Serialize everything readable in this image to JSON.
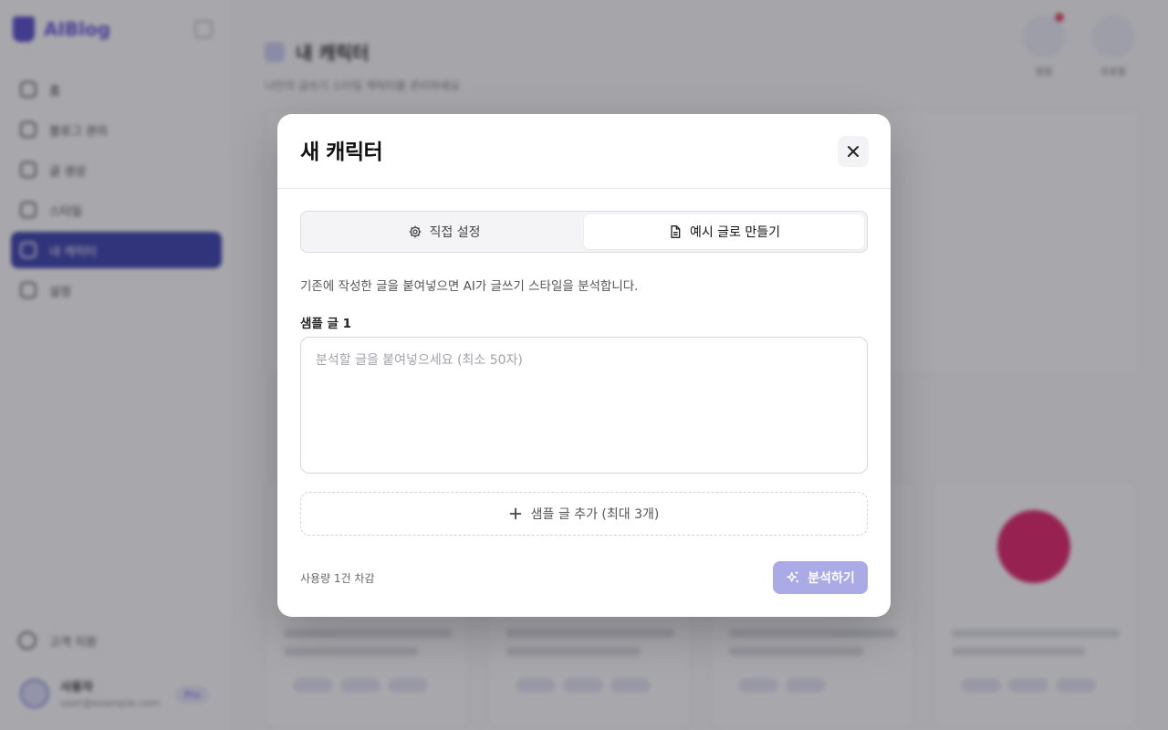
{
  "sidebar": {
    "brand": "AIBlog",
    "items": [
      {
        "label": "홈",
        "icon": "home-icon"
      },
      {
        "label": "블로그 관리",
        "icon": "link-icon"
      },
      {
        "label": "글 생성",
        "icon": "pen-icon"
      },
      {
        "label": "스타일",
        "icon": "palette-icon"
      },
      {
        "label": "내 캐릭터",
        "icon": "character-icon",
        "active": true
      },
      {
        "label": "설정",
        "icon": "gear-icon"
      }
    ],
    "bottom_link": "고객 지원",
    "user": {
      "name": "사용자",
      "email": "user@example.com",
      "plan": "Pro"
    }
  },
  "page": {
    "title": "내 캐릭터",
    "subtitle": "나만의 글쓰기 스타일 캐릭터를 관리하세요",
    "top_icons": [
      {
        "label": "알림",
        "icon": "bell-icon",
        "has_badge": true
      },
      {
        "label": "프로필",
        "icon": "profile-icon"
      }
    ]
  },
  "modal": {
    "title": "새 캐릭터",
    "tabs": [
      {
        "label": "직접 설정",
        "icon": "gear-icon",
        "active": false
      },
      {
        "label": "예시 글로 만들기",
        "icon": "document-icon",
        "active": true
      }
    ],
    "description": "기존에 작성한 글을 붙여넣으면 AI가 글쓰기 스타일을 분석합니다.",
    "sample_label": "샘플 글 1",
    "sample_placeholder": "분석할 글을 붙여넣으세요 (최소 50자)",
    "sample_value": "",
    "add_sample": "샘플 글 추가 (최대 3개)",
    "usage_note": "사용량 1건 차감",
    "analyze_button": "분석하기",
    "colors": {
      "primary_disabled": "#a9aae6",
      "overlay": "rgba(58,58,66,0.44)"
    }
  }
}
